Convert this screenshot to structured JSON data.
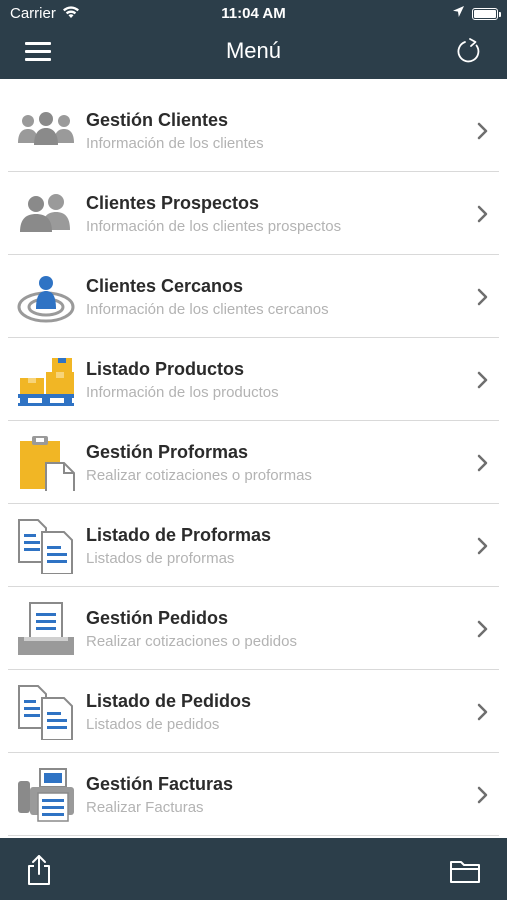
{
  "status_bar": {
    "carrier": "Carrier",
    "time": "11:04 AM",
    "wifi_icon": "wifi-icon",
    "location_icon": "location-arrow-icon",
    "battery_icon": "battery-icon"
  },
  "header": {
    "title": "Menú",
    "menu_icon": "hamburger-icon",
    "refresh_icon": "refresh-icon"
  },
  "menu": {
    "items": [
      {
        "title": "Gestión Clientes",
        "subtitle": "Información de los clientes",
        "icon": "group-users-icon"
      },
      {
        "title": "Clientes Prospectos",
        "subtitle": "Información de los clientes prospectos",
        "icon": "two-users-icon"
      },
      {
        "title": "Clientes Cercanos",
        "subtitle": "Información de los clientes cercanos",
        "icon": "nearby-user-icon"
      },
      {
        "title": "Listado Productos",
        "subtitle": "Información de los productos",
        "icon": "boxes-pallet-icon"
      },
      {
        "title": "Gestión Proformas",
        "subtitle": "Realizar cotizaciones o proformas",
        "icon": "clipboard-document-icon"
      },
      {
        "title": "Listado de Proformas",
        "subtitle": "Listados de proformas",
        "icon": "documents-list-icon"
      },
      {
        "title": "Gestión Pedidos",
        "subtitle": "Realizar cotizaciones o pedidos",
        "icon": "document-tray-icon"
      },
      {
        "title": "Listado de Pedidos",
        "subtitle": "Listados de pedidos",
        "icon": "documents-list-icon"
      },
      {
        "title": "Gestión Facturas",
        "subtitle": "Realizar Facturas",
        "icon": "fax-machine-icon"
      }
    ]
  },
  "bottom_bar": {
    "share_icon": "share-icon",
    "folder_icon": "folder-icon"
  },
  "colors": {
    "bar_background": "#2c3e4a",
    "title_text": "#2b2b2b",
    "subtitle_text": "#b3b3b3",
    "icon_gray": "#9a9a9a",
    "icon_blue": "#2f73c4",
    "icon_yellow": "#f1b625"
  }
}
